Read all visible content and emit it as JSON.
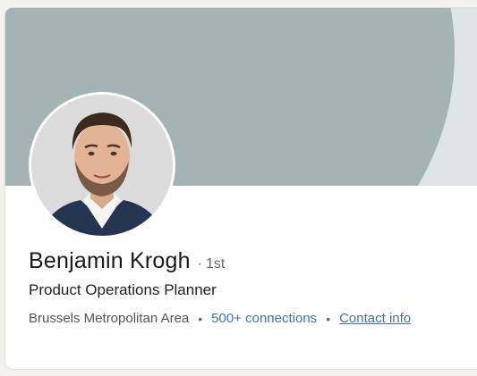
{
  "profile": {
    "name": "Benjamin Krogh",
    "degree_separator": "·",
    "degree": "1st",
    "headline": "Product Operations Planner",
    "location": "Brussels Metropolitan Area",
    "bullet": "•",
    "connections": "500+ connections",
    "contact_info": "Contact info"
  },
  "colors": {
    "banner": "#a4b3b4",
    "banner_background": "#dfe5e7",
    "link": "#3f73ad"
  }
}
